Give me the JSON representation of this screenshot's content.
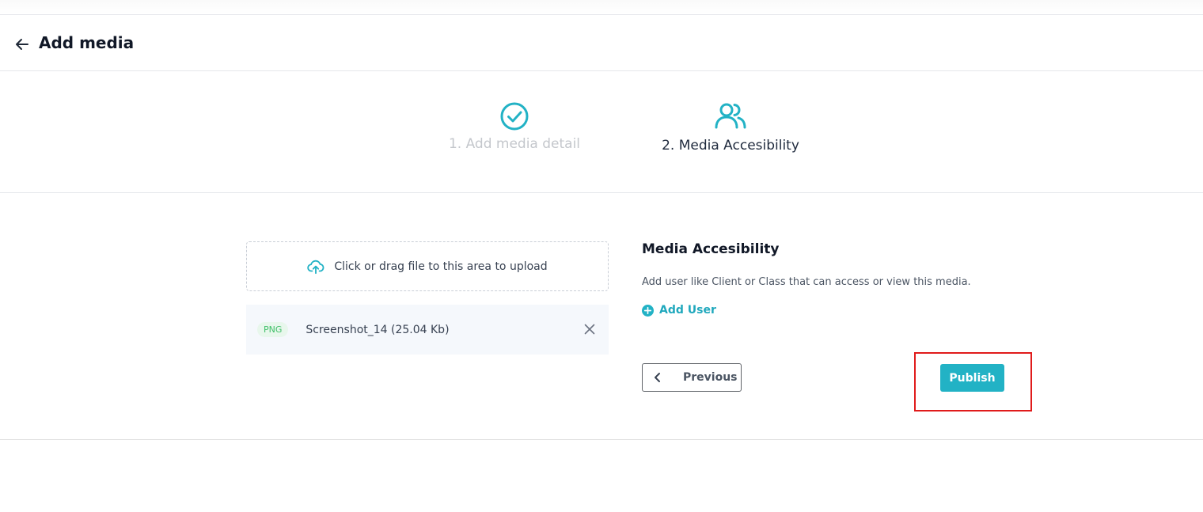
{
  "header": {
    "title": "Add media"
  },
  "steps": [
    {
      "label": "1. Add media detail",
      "state": "completed",
      "icon": "check-circle-icon"
    },
    {
      "label": "2. Media Accesibility",
      "state": "active",
      "icon": "users-icon"
    }
  ],
  "upload": {
    "dropzone_text": "Click or drag file to this area to upload",
    "file": {
      "type_badge": "PNG",
      "name": "Screenshot_14 (25.04 Kb)"
    }
  },
  "accessibility": {
    "title": "Media Accesibility",
    "description": "Add user like Client or Class that can access or view this media.",
    "add_user_label": "Add User"
  },
  "actions": {
    "previous_label": "Previous",
    "publish_label": "Publish"
  },
  "colors": {
    "accent": "#22b2c5",
    "highlight_box": "#e01b1b"
  }
}
